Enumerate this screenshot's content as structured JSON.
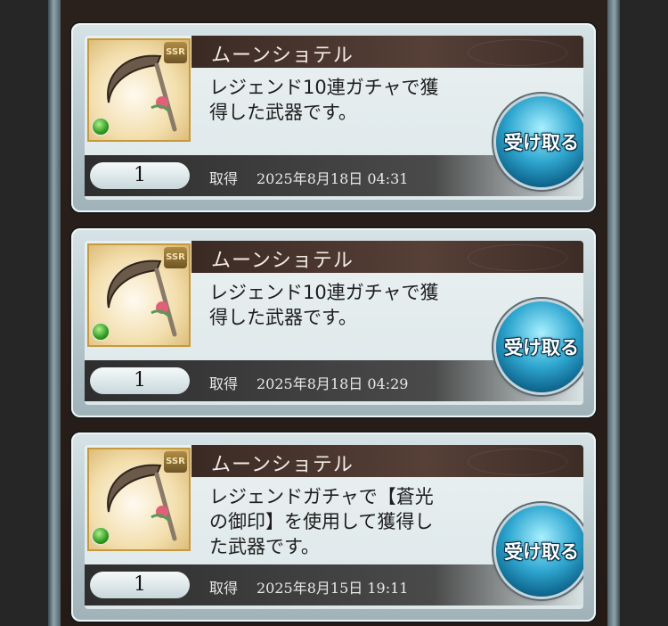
{
  "items": [
    {
      "title": "ムーンショテル",
      "description": "レジェンド10連ガチャで獲\n得した武器です。",
      "quantity": "1",
      "date_label": "取得",
      "date": "2025年8月18日 04:31",
      "rarity": "SSR",
      "button_label": "受け取る"
    },
    {
      "title": "ムーンショテル",
      "description": "レジェンド10連ガチャで獲\n得した武器です。",
      "quantity": "1",
      "date_label": "取得",
      "date": "2025年8月18日 04:29",
      "rarity": "SSR",
      "button_label": "受け取る"
    },
    {
      "title": "ムーンショテル",
      "description": "レジェンドガチャで【蒼光\nの御印】を使用して獲得し\nた武器です。",
      "quantity": "1",
      "date_label": "取得",
      "date": "2025年8月15日 19:11",
      "rarity": "SSR",
      "button_label": "受け取る"
    }
  ],
  "icons": {
    "weapon": "scythe-weapon-icon",
    "element": "wind-element-icon"
  }
}
